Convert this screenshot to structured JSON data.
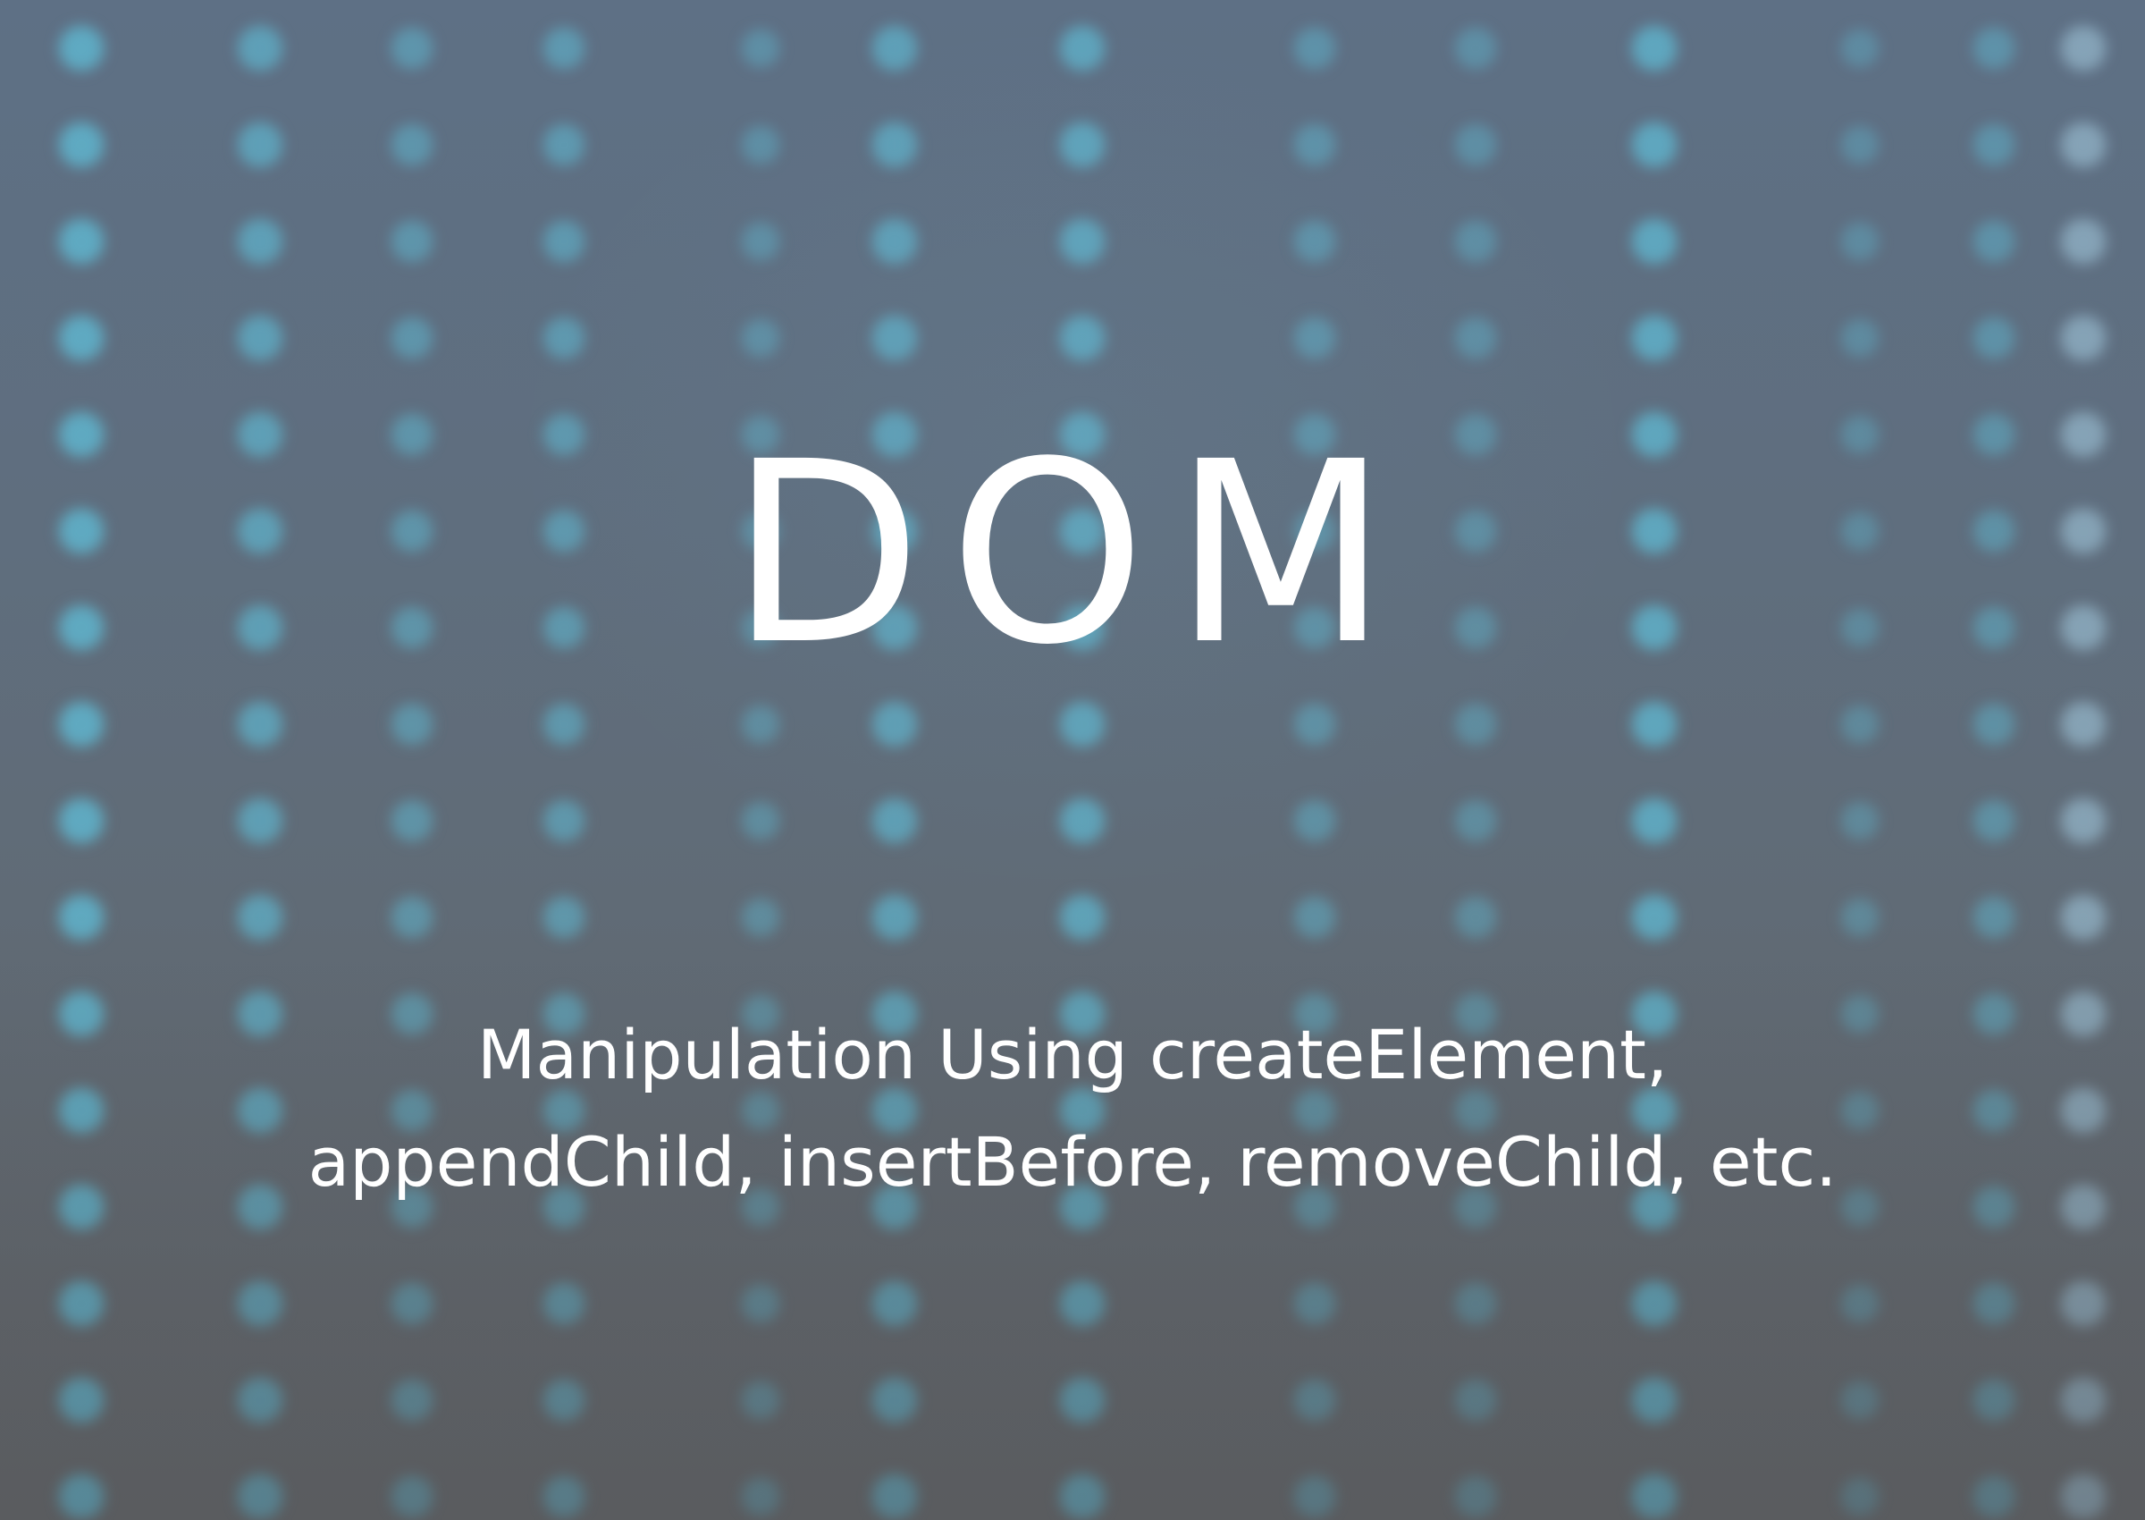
{
  "slide": {
    "title": "DOM",
    "subtitle_line1": "Manipulation Using createElement,",
    "subtitle_line2": "appendChild, insertBefore, removeChild, etc."
  },
  "colors": {
    "background_top": "#5e7085",
    "background_bottom": "#646669",
    "text": "#ffffff",
    "accent_dots": "#6fb6cc"
  }
}
